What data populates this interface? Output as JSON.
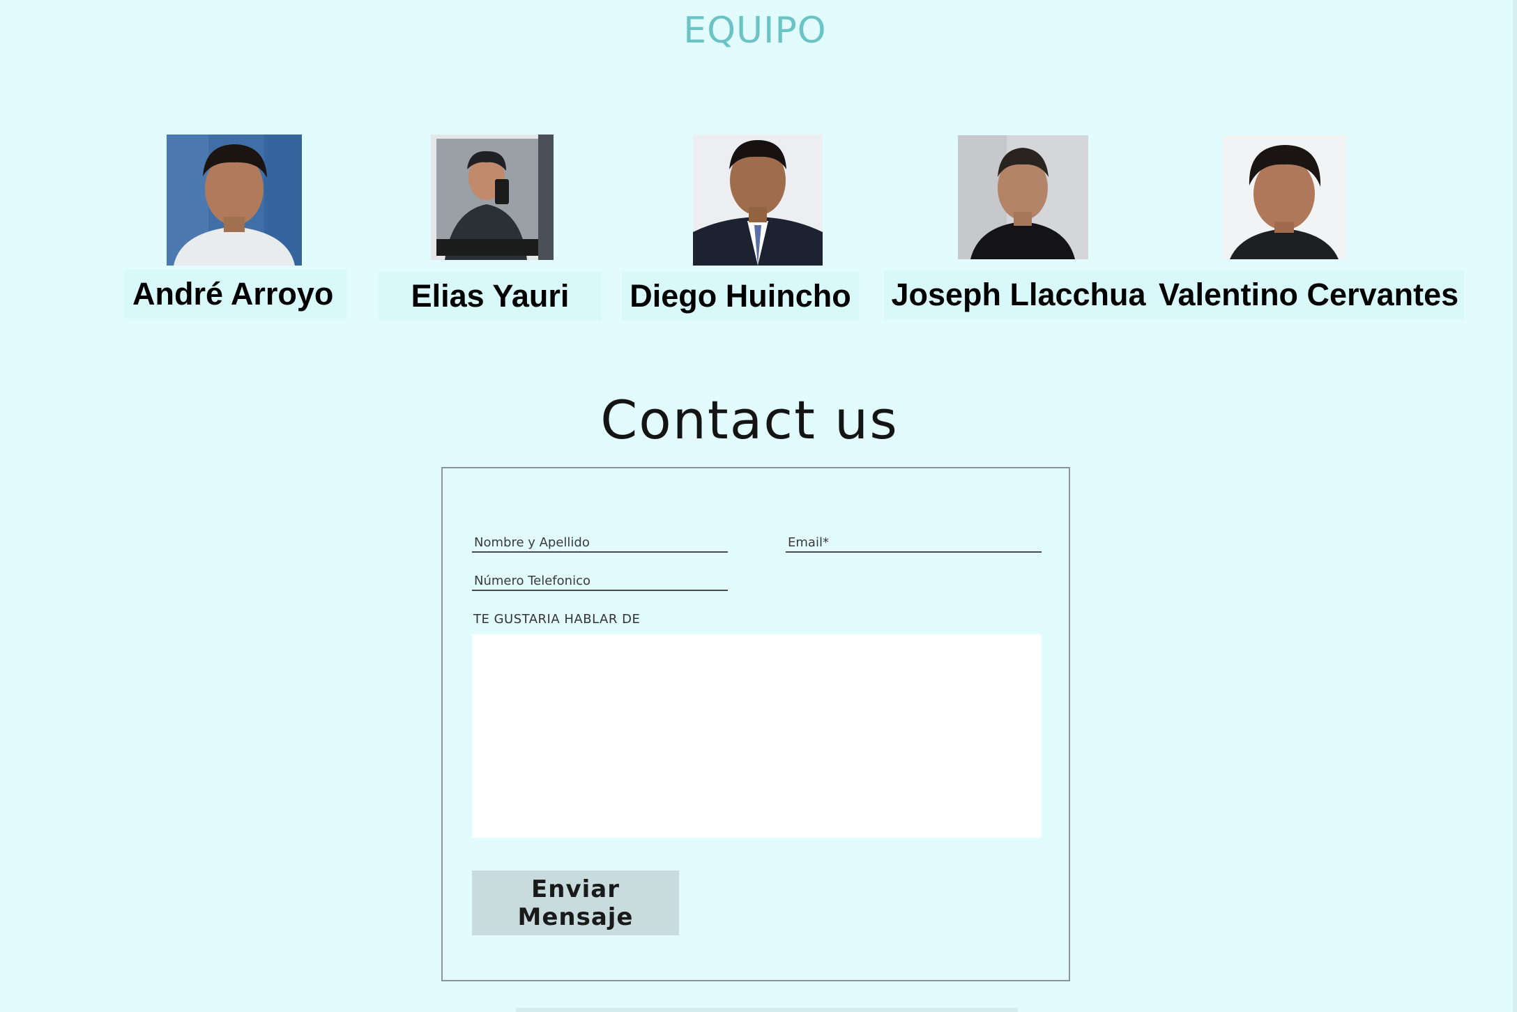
{
  "team": {
    "title": "EQUIPO",
    "members": [
      {
        "name": "André Arroyo",
        "photo": "portrait-photo"
      },
      {
        "name": "Elias Yauri",
        "photo": "mirror-selfie-photo"
      },
      {
        "name": "Diego Huincho",
        "photo": "formal-portrait-photo"
      },
      {
        "name": "Joseph Llacchua",
        "photo": "portrait-photo"
      },
      {
        "name": "Valentino Cervantes",
        "photo": "portrait-photo"
      }
    ]
  },
  "contact": {
    "title": "Contact us",
    "name_placeholder": "Nombre y Apellido",
    "email_placeholder": "Email*",
    "phone_placeholder": "Número Telefonico",
    "message_label": "TE GUSTARIA HABLAR DE",
    "submit_label": "Enviar Mensaje"
  },
  "colors": {
    "background": "#e2fbfc",
    "title_accent": "#6cc3c6",
    "button": "#c9dcdd"
  }
}
